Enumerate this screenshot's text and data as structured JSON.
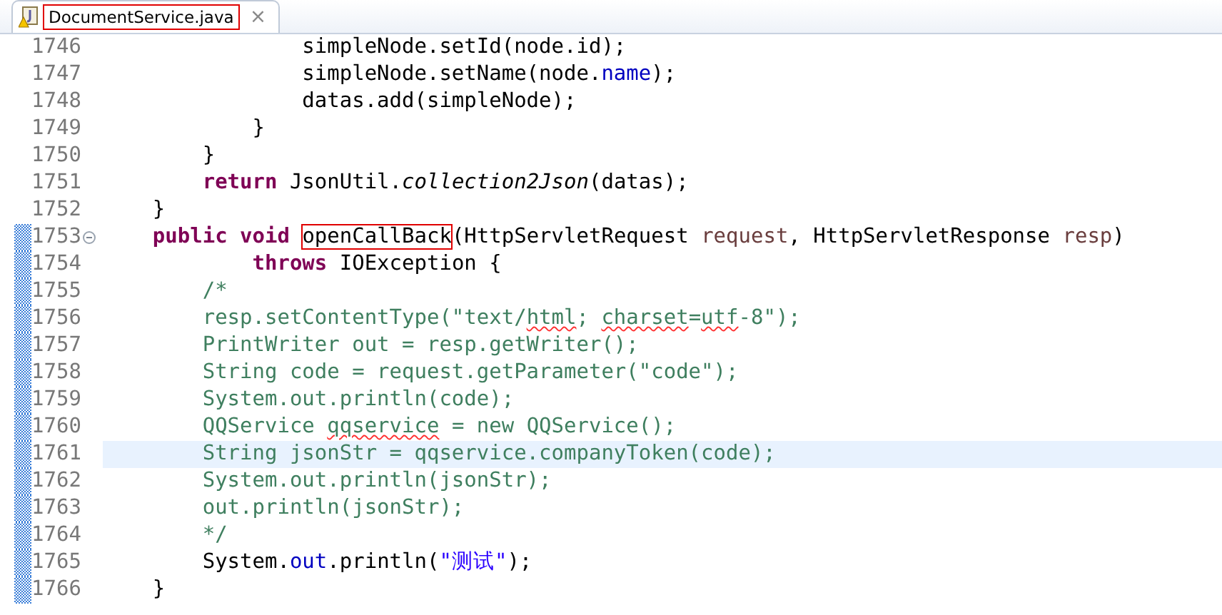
{
  "tab": {
    "title": "DocumentService.java",
    "selected": true,
    "annotated": true,
    "close": "×"
  },
  "lines": [
    {
      "number": "1746",
      "changed": false,
      "current": false,
      "foldable": false,
      "segments": [
        {
          "kind": "plain",
          "text": "                simpleNode.setId(node.id);"
        }
      ]
    },
    {
      "number": "1747",
      "changed": false,
      "current": false,
      "foldable": false,
      "segments": [
        {
          "kind": "plain",
          "text": "                simpleNode.setName(node."
        },
        {
          "kind": "field",
          "text": "name"
        },
        {
          "kind": "plain",
          "text": ");"
        }
      ]
    },
    {
      "number": "1748",
      "changed": false,
      "current": false,
      "foldable": false,
      "segments": [
        {
          "kind": "plain",
          "text": "                datas.add(simpleNode);"
        }
      ]
    },
    {
      "number": "1749",
      "changed": false,
      "current": false,
      "foldable": false,
      "segments": [
        {
          "kind": "plain",
          "text": "            }"
        }
      ]
    },
    {
      "number": "1750",
      "changed": false,
      "current": false,
      "foldable": false,
      "segments": [
        {
          "kind": "plain",
          "text": "        }"
        }
      ]
    },
    {
      "number": "1751",
      "changed": false,
      "current": false,
      "foldable": false,
      "segments": [
        {
          "kind": "keyword",
          "text": "        return"
        },
        {
          "kind": "plain",
          "text": " JsonUtil."
        },
        {
          "kind": "static",
          "text": "collection2Json"
        },
        {
          "kind": "plain",
          "text": "(datas);"
        }
      ]
    },
    {
      "number": "1752",
      "changed": false,
      "current": false,
      "foldable": false,
      "segments": [
        {
          "kind": "plain",
          "text": "    }"
        }
      ]
    },
    {
      "number": "1753",
      "changed": true,
      "current": false,
      "foldable": true,
      "segments": [
        {
          "kind": "keyword",
          "text": "    public void "
        },
        {
          "kind": "plain",
          "text": "openCallBack",
          "boxed": true
        },
        {
          "kind": "plain",
          "text": "(HttpServletRequest "
        },
        {
          "kind": "param",
          "text": "request"
        },
        {
          "kind": "plain",
          "text": ", HttpServletResponse "
        },
        {
          "kind": "param",
          "text": "resp"
        },
        {
          "kind": "plain",
          "text": ")"
        }
      ]
    },
    {
      "number": "1754",
      "changed": true,
      "current": false,
      "foldable": false,
      "segments": [
        {
          "kind": "keyword",
          "text": "            throws"
        },
        {
          "kind": "plain",
          "text": " IOException {"
        }
      ]
    },
    {
      "number": "1755",
      "changed": true,
      "current": false,
      "foldable": false,
      "segments": [
        {
          "kind": "comment",
          "text": "        /*"
        }
      ]
    },
    {
      "number": "1756",
      "changed": true,
      "current": false,
      "foldable": false,
      "segments": [
        {
          "kind": "comment",
          "text": "        resp.setContentType(\"text/"
        },
        {
          "kind": "comment",
          "text": "html",
          "misspelled": true
        },
        {
          "kind": "comment",
          "text": "; "
        },
        {
          "kind": "comment",
          "text": "charset",
          "misspelled": true
        },
        {
          "kind": "comment",
          "text": "="
        },
        {
          "kind": "comment",
          "text": "utf",
          "misspelled": true
        },
        {
          "kind": "comment",
          "text": "-8\");"
        }
      ]
    },
    {
      "number": "1757",
      "changed": true,
      "current": false,
      "foldable": false,
      "segments": [
        {
          "kind": "comment",
          "text": "        PrintWriter out = resp.getWriter();"
        }
      ]
    },
    {
      "number": "1758",
      "changed": true,
      "current": false,
      "foldable": false,
      "segments": [
        {
          "kind": "comment",
          "text": "        String code = request.getParameter(\"code\");"
        }
      ]
    },
    {
      "number": "1759",
      "changed": true,
      "current": false,
      "foldable": false,
      "segments": [
        {
          "kind": "comment",
          "text": "        System.out.println(code);"
        }
      ]
    },
    {
      "number": "1760",
      "changed": true,
      "current": false,
      "foldable": false,
      "segments": [
        {
          "kind": "comment",
          "text": "        QQService "
        },
        {
          "kind": "comment",
          "text": "qqservice",
          "misspelled": true
        },
        {
          "kind": "comment",
          "text": " = new QQService();"
        }
      ]
    },
    {
      "number": "1761",
      "changed": true,
      "current": true,
      "foldable": false,
      "segments": [
        {
          "kind": "comment",
          "text": "        String jsonStr = qqservice.companyToken(code);"
        }
      ]
    },
    {
      "number": "1762",
      "changed": true,
      "current": false,
      "foldable": false,
      "segments": [
        {
          "kind": "comment",
          "text": "        System.out.println(jsonStr);"
        }
      ]
    },
    {
      "number": "1763",
      "changed": true,
      "current": false,
      "foldable": false,
      "segments": [
        {
          "kind": "comment",
          "text": "        out.println(jsonStr);"
        }
      ]
    },
    {
      "number": "1764",
      "changed": true,
      "current": false,
      "foldable": false,
      "segments": [
        {
          "kind": "comment",
          "text": "        */"
        }
      ]
    },
    {
      "number": "1765",
      "changed": true,
      "current": false,
      "foldable": false,
      "segments": [
        {
          "kind": "plain",
          "text": "        System."
        },
        {
          "kind": "field",
          "text": "out"
        },
        {
          "kind": "plain",
          "text": ".println("
        },
        {
          "kind": "string",
          "text": "\"测试\""
        },
        {
          "kind": "plain",
          "text": ");"
        }
      ]
    },
    {
      "number": "1766",
      "changed": true,
      "current": false,
      "foldable": false,
      "segments": [
        {
          "kind": "plain",
          "text": "    }"
        }
      ]
    }
  ]
}
